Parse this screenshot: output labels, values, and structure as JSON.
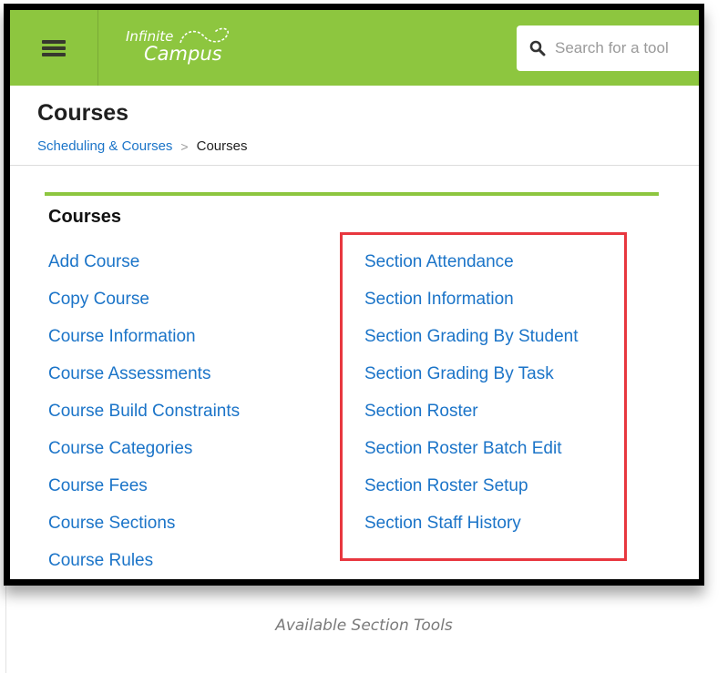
{
  "app": {
    "logo_line1": "Infinite",
    "logo_line2": "Campus"
  },
  "search": {
    "placeholder": "Search for a tool"
  },
  "page": {
    "title": "Courses",
    "breadcrumb": {
      "parent": "Scheduling & Courses",
      "separator": ">",
      "current": "Courses"
    }
  },
  "courses_section": {
    "heading": "Courses",
    "left_links": [
      "Add Course",
      "Copy Course",
      "Course Information",
      "Course Assessments",
      "Course Build Constraints",
      "Course Categories",
      "Course Fees",
      "Course Sections",
      "Course Rules"
    ],
    "right_links": [
      "Section Attendance",
      "Section Information",
      "Section Grading By Student",
      "Section Grading By Task",
      "Section Roster",
      "Section Roster Batch Edit",
      "Section Roster Setup",
      "Section Staff History"
    ]
  },
  "caption": "Available Section Tools",
  "colors": {
    "header_green": "#8dc63f",
    "link_blue": "#1b74c8",
    "highlight_red": "#e8373f"
  }
}
